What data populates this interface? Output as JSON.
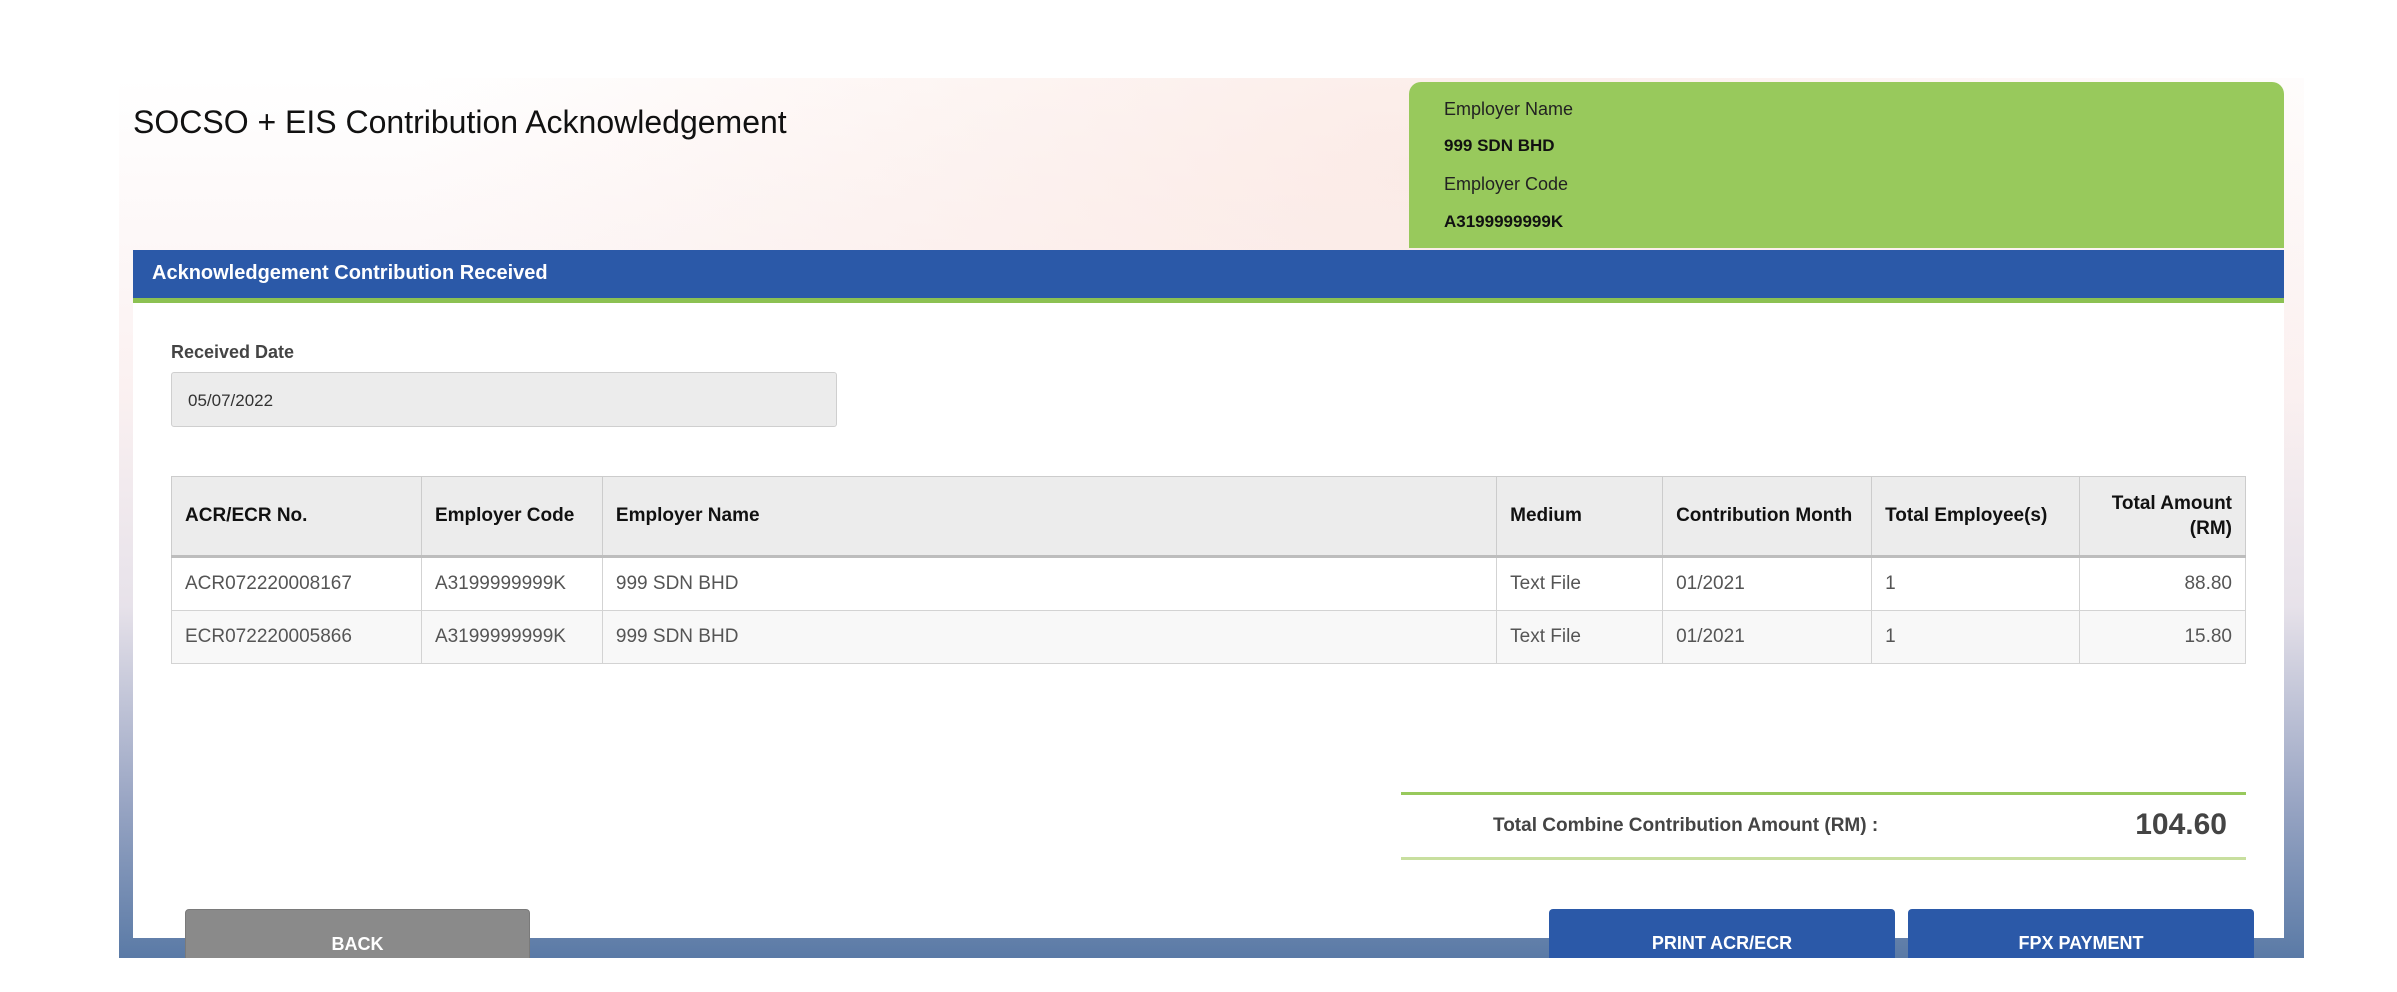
{
  "page": {
    "title": "SOCSO + EIS Contribution Acknowledgement"
  },
  "employer": {
    "name_label": "Employer Name",
    "name_value": "999 SDN BHD",
    "code_label": "Employer Code",
    "code_value": "A3199999999K"
  },
  "panel": {
    "header": "Acknowledgement Contribution Received",
    "received_date_label": "Received Date",
    "received_date_value": "05/07/2022"
  },
  "table": {
    "columns": [
      "ACR/ECR No.",
      "Employer Code",
      "Employer Name",
      "Medium",
      "Contribution Month",
      "Total Employee(s)",
      "Total Amount (RM)"
    ],
    "rows": [
      [
        "ACR072220008167",
        "A3199999999K",
        "999 SDN BHD",
        "Text File",
        "01/2021",
        "1",
        "88.80"
      ],
      [
        "ECR072220005866",
        "A3199999999K",
        "999 SDN BHD",
        "Text File",
        "01/2021",
        "1",
        "15.80"
      ]
    ]
  },
  "total": {
    "label": "Total Combine Contribution Amount (RM) :",
    "value": "104.60"
  },
  "buttons": {
    "back": "BACK",
    "print": "PRINT ACR/ECR",
    "fpx": "FPX PAYMENT"
  },
  "colors": {
    "primary_blue": "#2b59a8",
    "accent_green": "#98c95c",
    "back_gray": "#8a8a8a"
  }
}
